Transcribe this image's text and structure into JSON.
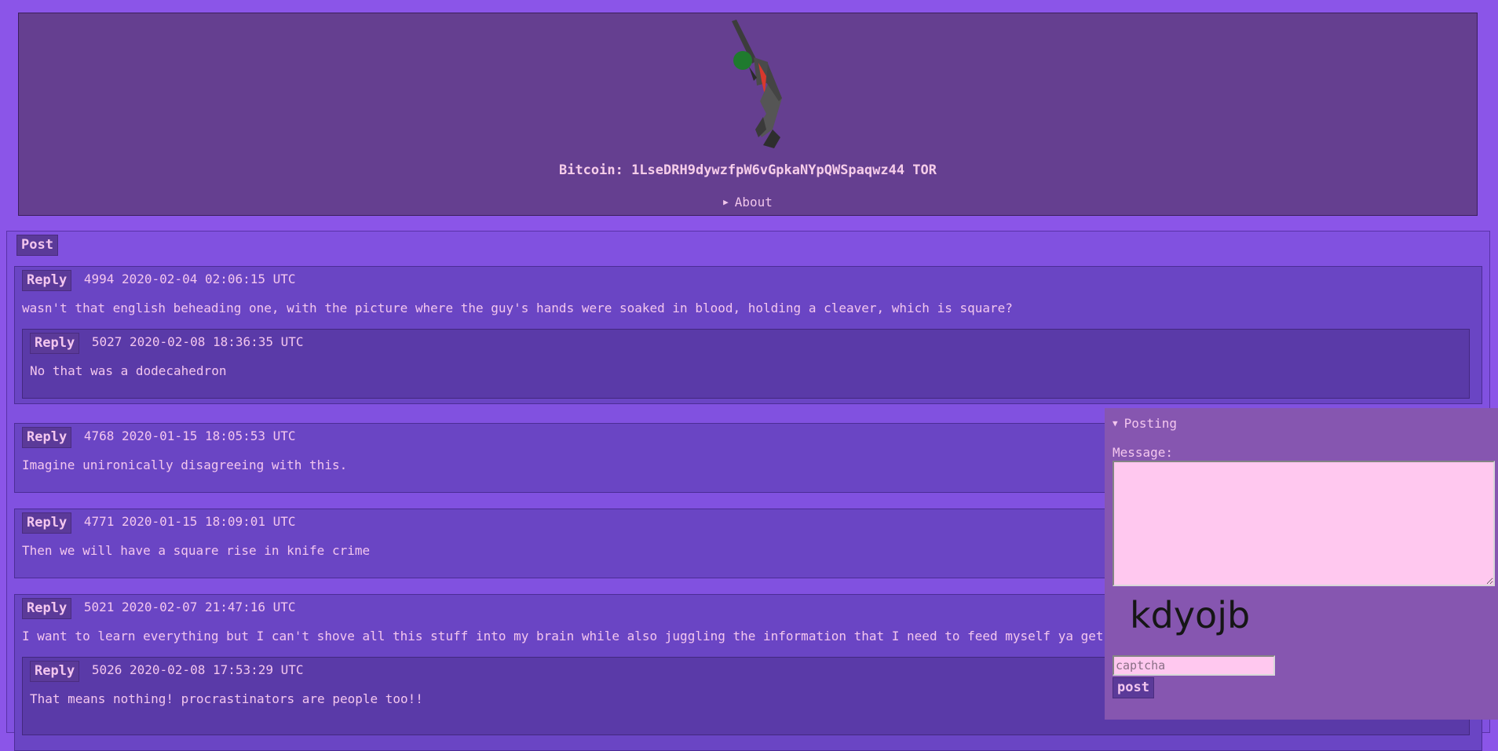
{
  "header": {
    "bitcoin_text": "Bitcoin: 1LseDRH9dywzfpW6vGpkaNYpQWSpaqwz44 TOR",
    "about_label": "About"
  },
  "board": {
    "post_label": "Post",
    "reply_label": "Reply",
    "threads": [
      {
        "id": "4994",
        "time": "2020-02-04 02:06:15 UTC",
        "text": "wasn't that english beheading one, with the picture where the guy's hands were soaked in blood, holding a cleaver, which is square?",
        "replies": [
          {
            "id": "5027",
            "time": "2020-02-08 18:36:35 UTC",
            "text": "No that was a dodecahedron"
          }
        ]
      },
      {
        "id": "4768",
        "time": "2020-01-15 18:05:53 UTC",
        "text": "Imagine unironically disagreeing with this."
      },
      {
        "id": "4771",
        "time": "2020-01-15 18:09:01 UTC",
        "text": "Then we will have a square rise in knife crime"
      },
      {
        "id": "5021",
        "time": "2020-02-07 21:47:16 UTC",
        "text": "I want to learn everything but I can't shove all this stuff into my brain while also juggling the information that I need to feed myself ya get",
        "replies": [
          {
            "id": "5026",
            "time": "2020-02-08 17:53:29 UTC",
            "text": "That means nothing! procrastinators are people too!!"
          }
        ]
      }
    ]
  },
  "posting": {
    "summary": "Posting",
    "message_label": "Message:",
    "message_value": "",
    "captcha_text": "kdyojb",
    "captcha_placeholder": "captcha",
    "post_button": "post"
  },
  "colors": {
    "background": "#8b55e8",
    "header_bg": "#653f90",
    "thread_bg": "#6a45c4",
    "reply_bg": "#5a3aa8",
    "text": "#f3c6ee",
    "input_bg": "#ffc8ef"
  }
}
